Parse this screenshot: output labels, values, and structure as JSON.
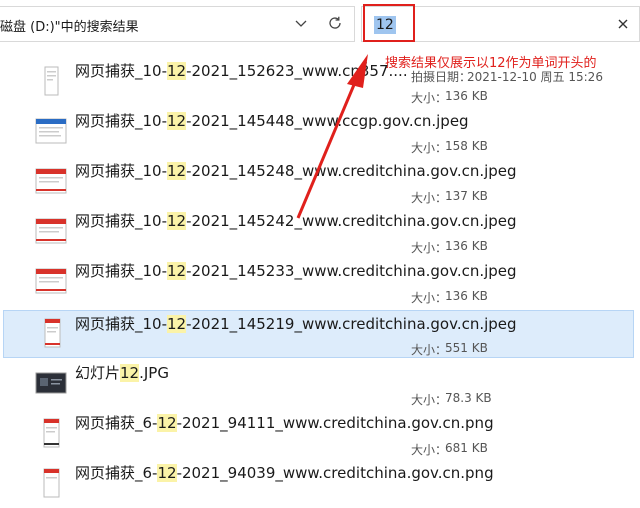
{
  "address_bar": {
    "path": "磁盘 (D:)\"中的搜索结果"
  },
  "search": {
    "query": "12"
  },
  "annotation": {
    "text": "搜索结果仅展示以12作为单词开头的",
    "color": "#e0201c"
  },
  "files": [
    {
      "name_pre": "网页捕获_10-",
      "name_hl": "12",
      "name_post": "-2021_152623_www.cn3̈57....",
      "date_label": "拍摄日期：",
      "date": "2021-12-10 周五 15:26",
      "size_label": "大小：",
      "size": "136 KB",
      "thumb": "document-portrait",
      "selected": false
    },
    {
      "name_pre": "网页捕获_10-",
      "name_hl": "12",
      "name_post": "-2021_145448_www.ccgp.gov.cn.jpeg",
      "size_label": "大小：",
      "size": "158 KB",
      "thumb": "webpage-blue",
      "selected": false
    },
    {
      "name_pre": "网页捕获_10-",
      "name_hl": "12",
      "name_post": "-2021_145248_www.creditchina.gov.cn.jpeg",
      "size_label": "大小：",
      "size": "137 KB",
      "thumb": "webpage-red",
      "selected": false
    },
    {
      "name_pre": "网页捕获_10-",
      "name_hl": "12",
      "name_post": "-2021_145242_www.creditchina.gov.cn.jpeg",
      "size_label": "大小：",
      "size": "136 KB",
      "thumb": "webpage-red",
      "selected": false
    },
    {
      "name_pre": "网页捕获_10-",
      "name_hl": "12",
      "name_post": "-2021_145233_www.creditchina.gov.cn.jpeg",
      "size_label": "大小：",
      "size": "136 KB",
      "thumb": "webpage-red",
      "selected": false
    },
    {
      "name_pre": "网页捕获_10-",
      "name_hl": "12",
      "name_post": "-2021_145219_www.creditchina.gov.cn.jpeg",
      "size_label": "大小：",
      "size": "551 KB",
      "thumb": "document-red-portrait",
      "selected": true
    },
    {
      "name_pre": "幻灯片",
      "name_hl": "12",
      "name_post": ".JPG",
      "size_label": "大小：",
      "size": "78.3 KB",
      "thumb": "slide-dark",
      "selected": false
    },
    {
      "name_pre": "网页捕获_6-",
      "name_hl": "12",
      "name_post": "-2021_94111_www.creditchina.gov.cn.png",
      "size_label": "大小：",
      "size": "681 KB",
      "thumb": "document-red-portrait",
      "selected": false
    },
    {
      "name_pre": "网页捕获_6-",
      "name_hl": "12",
      "name_post": "-2021_94039_www.creditchina.gov.cn.png",
      "size_label": "",
      "size": "",
      "thumb": "document-red-portrait",
      "selected": false
    }
  ]
}
